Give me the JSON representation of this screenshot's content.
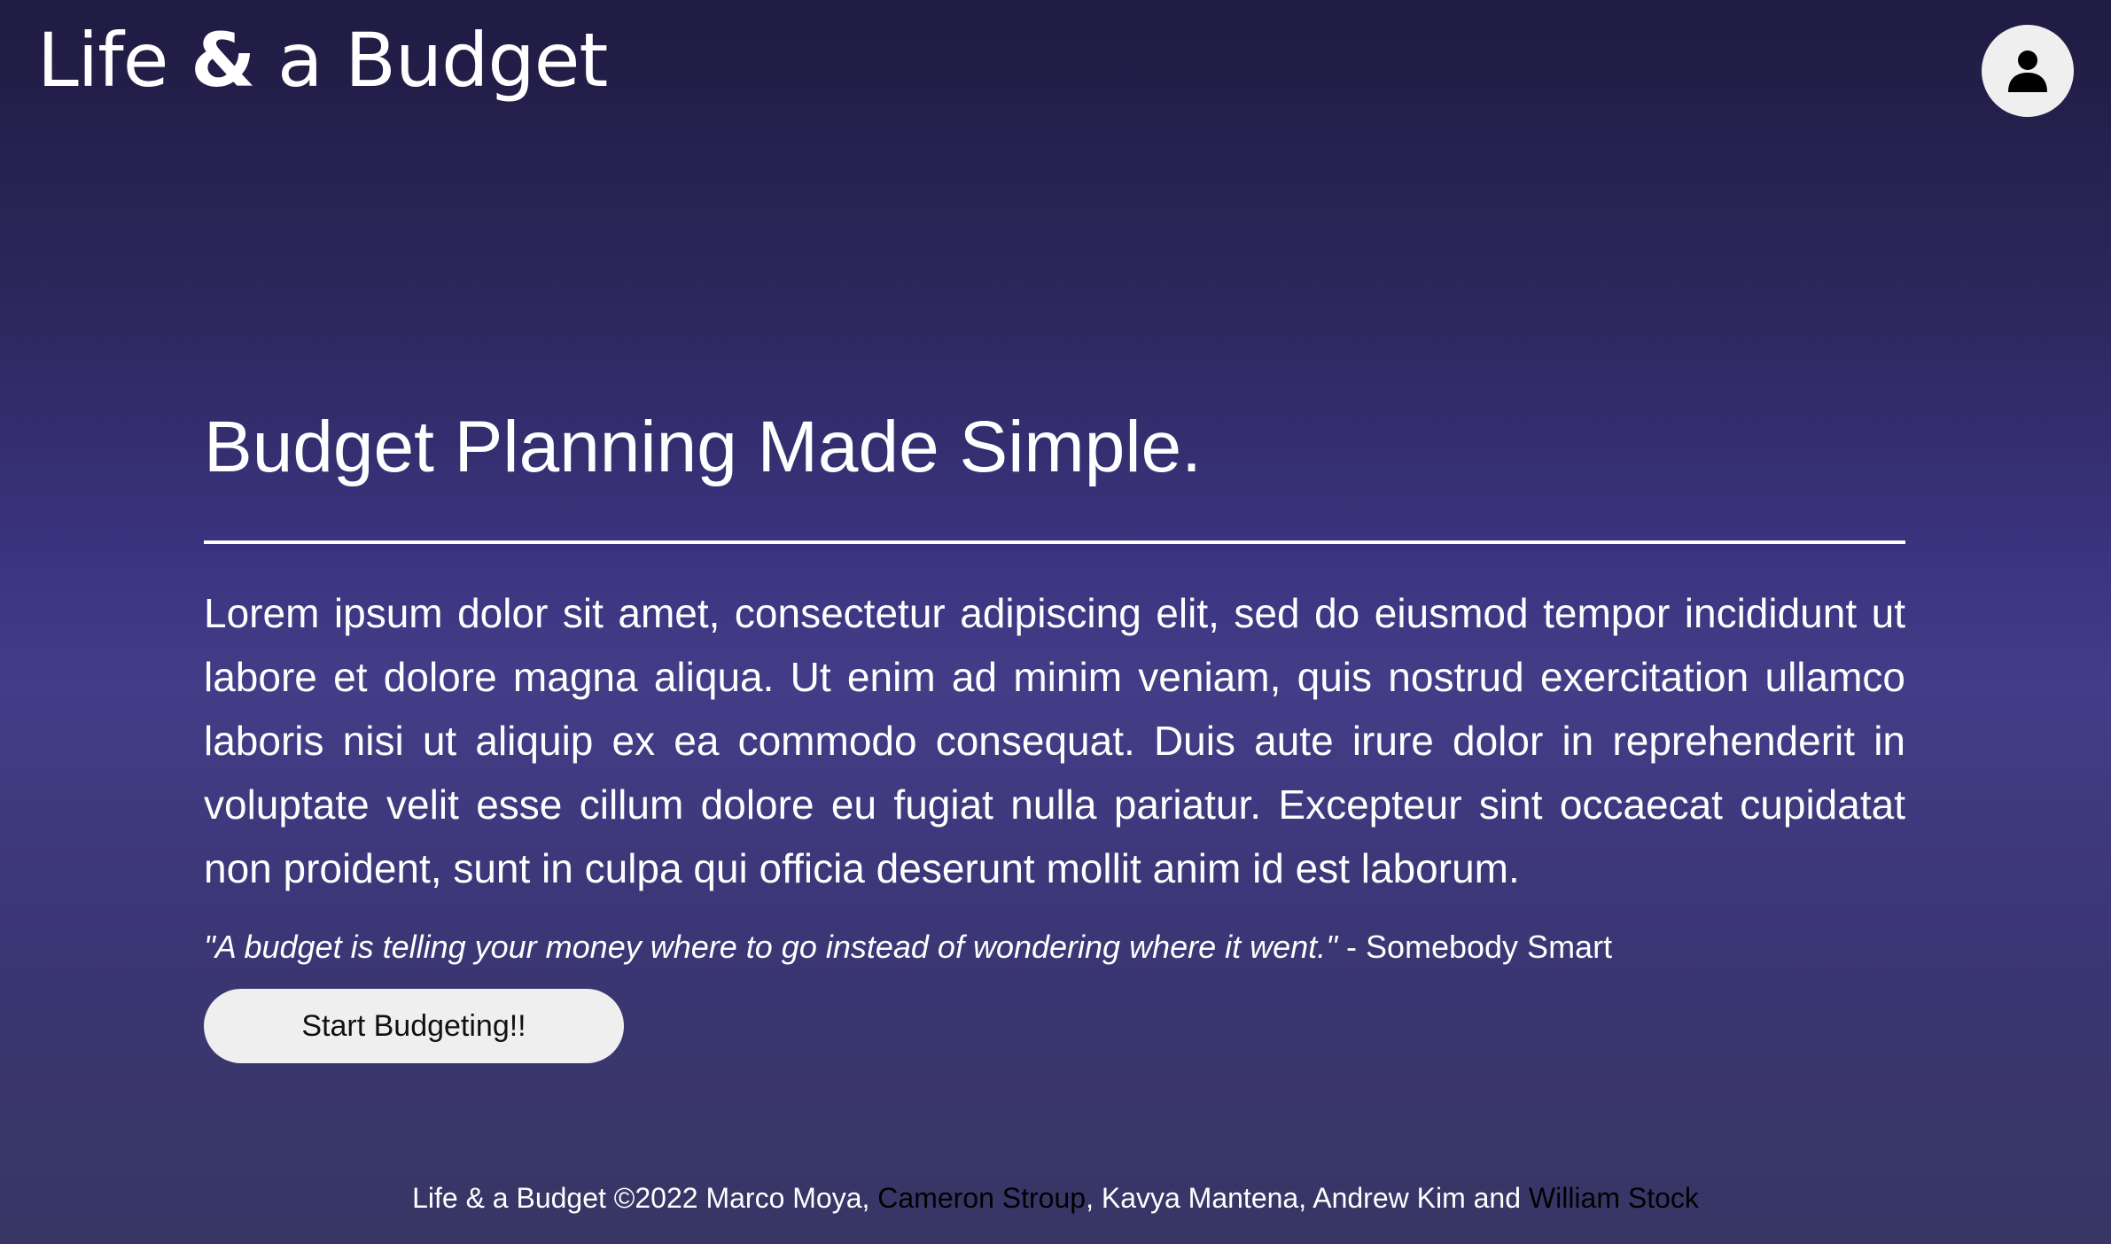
{
  "header": {
    "brand_part1": "Life ",
    "brand_amp": "&",
    "brand_part2": " a Budget",
    "profile_icon": "user-icon"
  },
  "hero": {
    "title": "Budget Planning Made Simple.",
    "body": "Lorem ipsum dolor sit amet, consectetur adipiscing elit, sed do eiusmod tempor incididunt ut labore et dolore magna aliqua. Ut enim ad minim veniam, quis nostrud exercitation ullamco laboris nisi ut aliquip ex ea commodo consequat. Duis aute irure dolor in reprehenderit in voluptate velit esse cillum dolore eu fugiat nulla pariatur. Excepteur sint occaecat cupidatat non proident, sunt in culpa qui officia deserunt mollit anim id est laborum.",
    "quote_text": "\"A budget is telling your money where to go instead of wondering where it went.\"",
    "quote_attribution": " - Somebody Smart",
    "cta_label": "Start Budgeting!!"
  },
  "footer": {
    "prefix": "Life & a Budget ©2022 Marco Moya, ",
    "link1": "Cameron Stroup",
    "middle": ", Kavya Mantena, Andrew Kim and ",
    "link2": "William Stock"
  },
  "colors": {
    "background_top": "#1f1b42",
    "background_mid": "#433d88",
    "background_bottom": "#383664",
    "button_bg": "#efefef",
    "text": "#ffffff",
    "link": "#000000"
  }
}
